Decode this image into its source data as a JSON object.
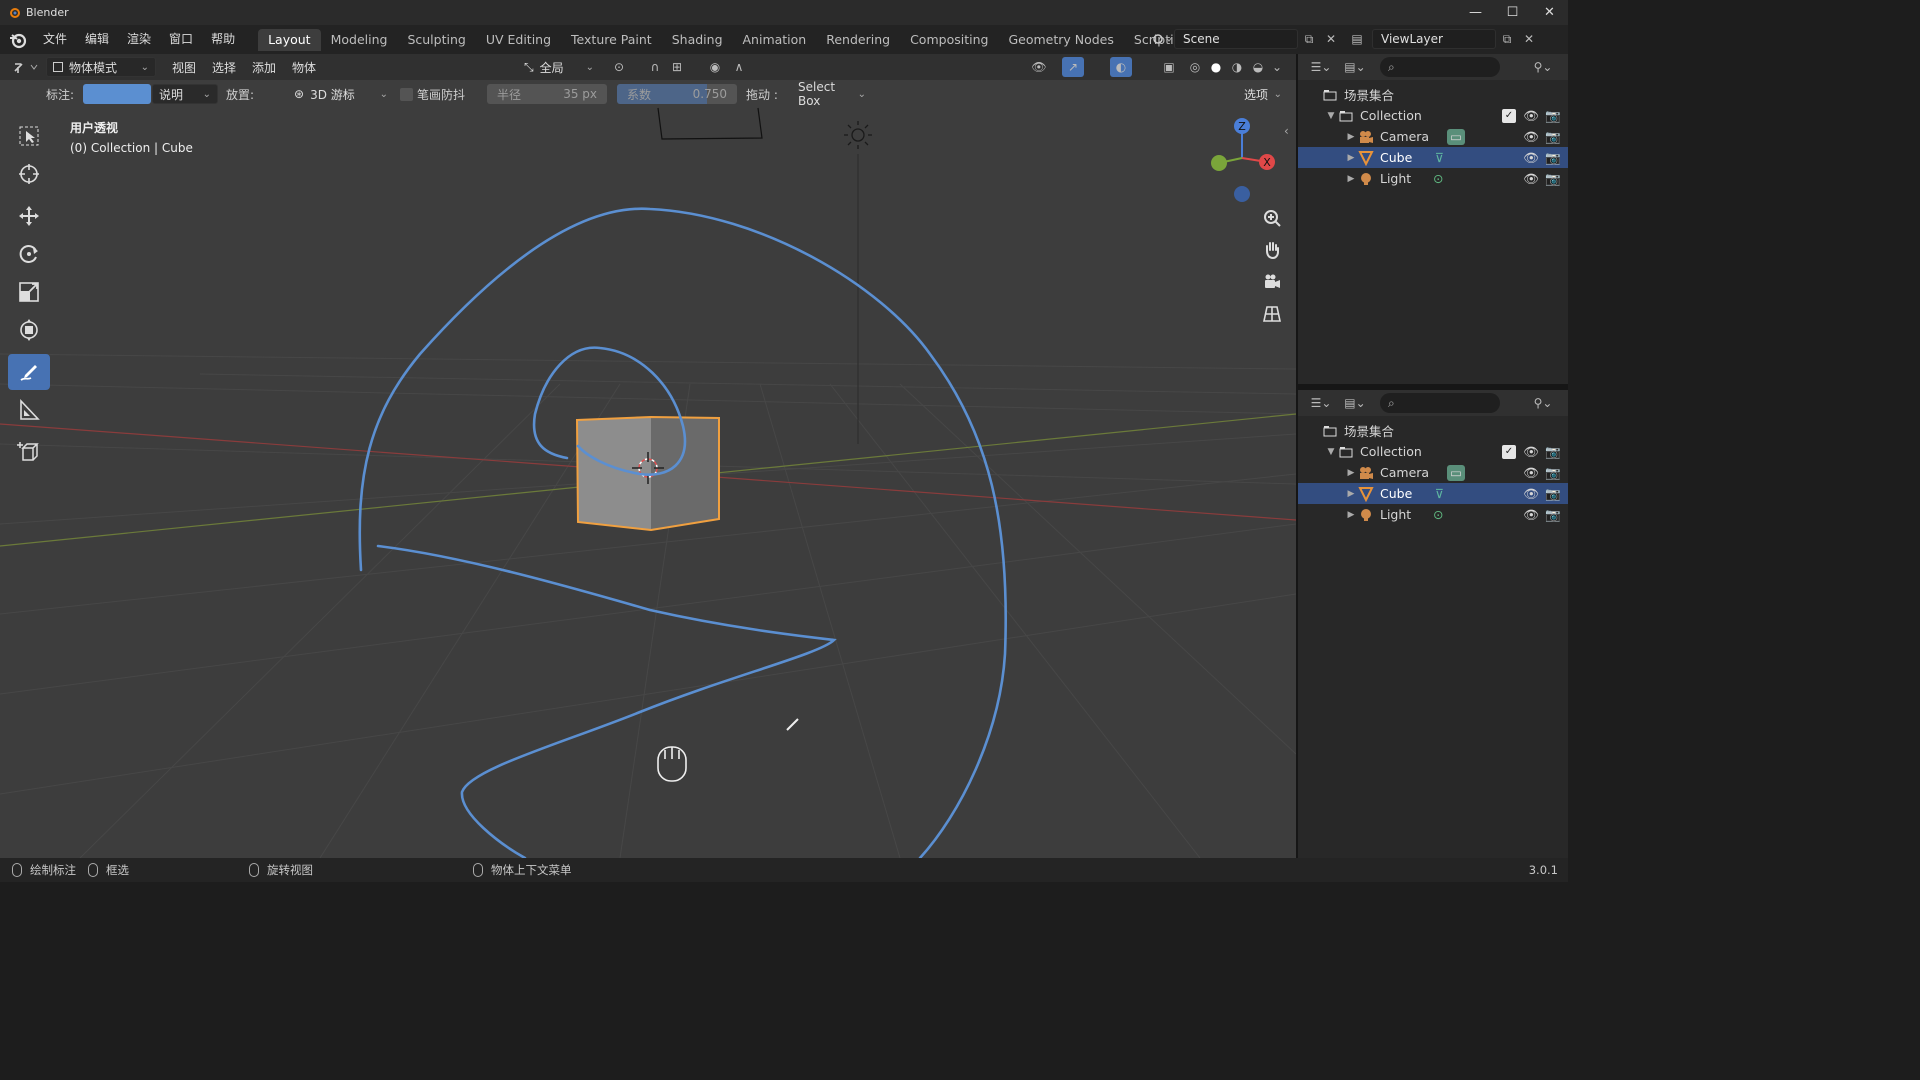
{
  "window": {
    "title": "Blender",
    "controls": [
      "—",
      "☐",
      "✕"
    ]
  },
  "menu": [
    "文件",
    "编辑",
    "渲染",
    "窗口",
    "帮助"
  ],
  "workspaces": [
    "Layout",
    "Modeling",
    "Sculpting",
    "UV Editing",
    "Texture Paint",
    "Shading",
    "Animation",
    "Rendering",
    "Compositing",
    "Geometry Nodes",
    "Scripting"
  ],
  "active_workspace": "Layout",
  "workspace_add": "+",
  "scene": {
    "name": "Scene",
    "view_layer": "ViewLayer"
  },
  "viewport_header": {
    "mode": "物体模式",
    "menus": [
      "视图",
      "选择",
      "添加",
      "物体"
    ],
    "transform_orientation": "全局",
    "options": "选项"
  },
  "tool_settings": {
    "annotate_label": "标注:",
    "annotate_color": "#5b8fd1",
    "note_dropdown": "说明",
    "placement_label": "放置:",
    "placement_value": "3D 游标",
    "stabilize_label": "笔画防抖",
    "radius_label": "半径",
    "radius_value": "35 px",
    "factor_label": "系数",
    "factor_value": "0.750",
    "factor_fraction": 0.75,
    "drag_label": "拖动 :",
    "drag_value": "Select Box"
  },
  "viewport_overlay": {
    "view_name": "用户透视",
    "context": "(0) Collection | Cube"
  },
  "gizmo_axes": {
    "z": "Z",
    "x": "X"
  },
  "outliner": {
    "root": "场景集合",
    "collection": "Collection",
    "items": [
      {
        "name": "Camera",
        "selected": false,
        "color": "#d08a4a"
      },
      {
        "name": "Cube",
        "selected": true,
        "color": "#e8933a"
      },
      {
        "name": "Light",
        "selected": false,
        "color": "#d08a4a"
      }
    ]
  },
  "status_bar": {
    "left_action": "绘制标注",
    "middle_action": "框选",
    "rotate_action": "旋转视图",
    "context_menu": "物体上下文菜单",
    "version": "3.0.1"
  },
  "colors": {
    "accent": "#4772b3",
    "selection_orange": "#f0a040",
    "annotation": "#5b8fd1"
  }
}
